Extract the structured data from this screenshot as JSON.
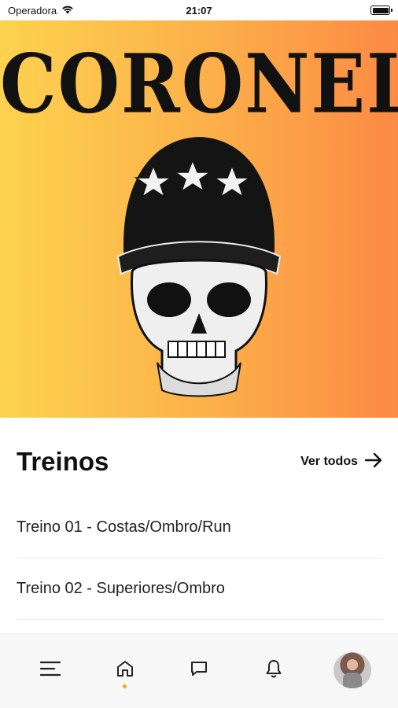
{
  "status_bar": {
    "carrier": "Operadora",
    "time": "21:07"
  },
  "hero": {
    "brand_text": "CORONEL"
  },
  "section": {
    "title": "Treinos",
    "see_all_label": "Ver todos"
  },
  "workouts": [
    {
      "label": "Treino 01 - Costas/Ombro/Run"
    },
    {
      "label": "Treino 02 - Superiores/Ombro"
    }
  ],
  "bottom_nav": {
    "items": [
      {
        "icon": "menu-icon"
      },
      {
        "icon": "home-icon",
        "active": true
      },
      {
        "icon": "chat-icon"
      },
      {
        "icon": "bell-icon"
      },
      {
        "icon": "avatar"
      }
    ],
    "active_dot_color": "#f5a623"
  },
  "colors": {
    "hero_start": "#fdd24f",
    "hero_end": "#fc8a44"
  }
}
